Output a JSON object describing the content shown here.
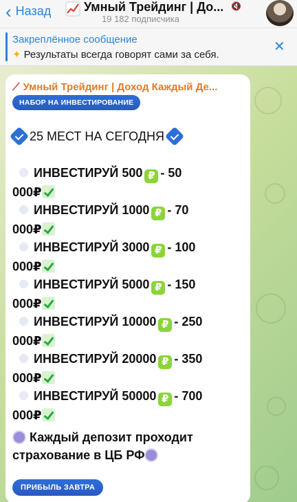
{
  "header": {
    "back_label": "Назад",
    "channel_title": "Умный Трейдинг | До...",
    "subscribers": "19 182 подписчика"
  },
  "pinned": {
    "title": "Закреплённое сообщение",
    "text": "Результаты всегда говорят сами за себя."
  },
  "message": {
    "sender": "Умный Трейдинг | Доход Каждый Де...",
    "badge": "НАБОР НА ИНВЕСТИРОВАНИЕ",
    "headline": "25 МЕСТ НА СЕГОДНЯ",
    "items": [
      {
        "a": "ИНВЕСТИРУЙ 500",
        "b": "-  50",
        "c": "000₽"
      },
      {
        "a": "ИНВЕСТИРУЙ 1000",
        "b": "- 70",
        "c": "000₽"
      },
      {
        "a": "ИНВЕСТИРУЙ 3000",
        "b": "- 100",
        "c": "000₽"
      },
      {
        "a": "ИНВЕСТИРУЙ 5000",
        "b": "- 150",
        "c": "000₽"
      },
      {
        "a": "ИНВЕСТИРУЙ 10000",
        "b": "- 250",
        "c": "000₽"
      },
      {
        "a": "ИНВЕСТИРУЙ 20000",
        "b": "- 350",
        "c": "000₽"
      },
      {
        "a": "ИНВЕСТИРУЙ 50000",
        "b": "- 700",
        "c": "000₽"
      }
    ],
    "deposit_line1": "Каждый депозит проходит",
    "deposit_line2": "страхование в ЦБ РФ",
    "profit_button": "ПРИБЫЛЬ ЗАВТРА"
  },
  "colors": {
    "accent": "#2a85d8",
    "sender": "#e07a2d",
    "badge": "#2d6fd8"
  },
  "icons": {
    "back": "chevron-left-icon",
    "chart": "chart-up-icon",
    "mute": "muted-icon",
    "sparkles": "sparkles-icon",
    "close": "close-icon",
    "verified": "verified-check-icon",
    "coin": "ruble-coin-icon",
    "check": "green-check-icon",
    "seal": "bank-seal-icon"
  }
}
